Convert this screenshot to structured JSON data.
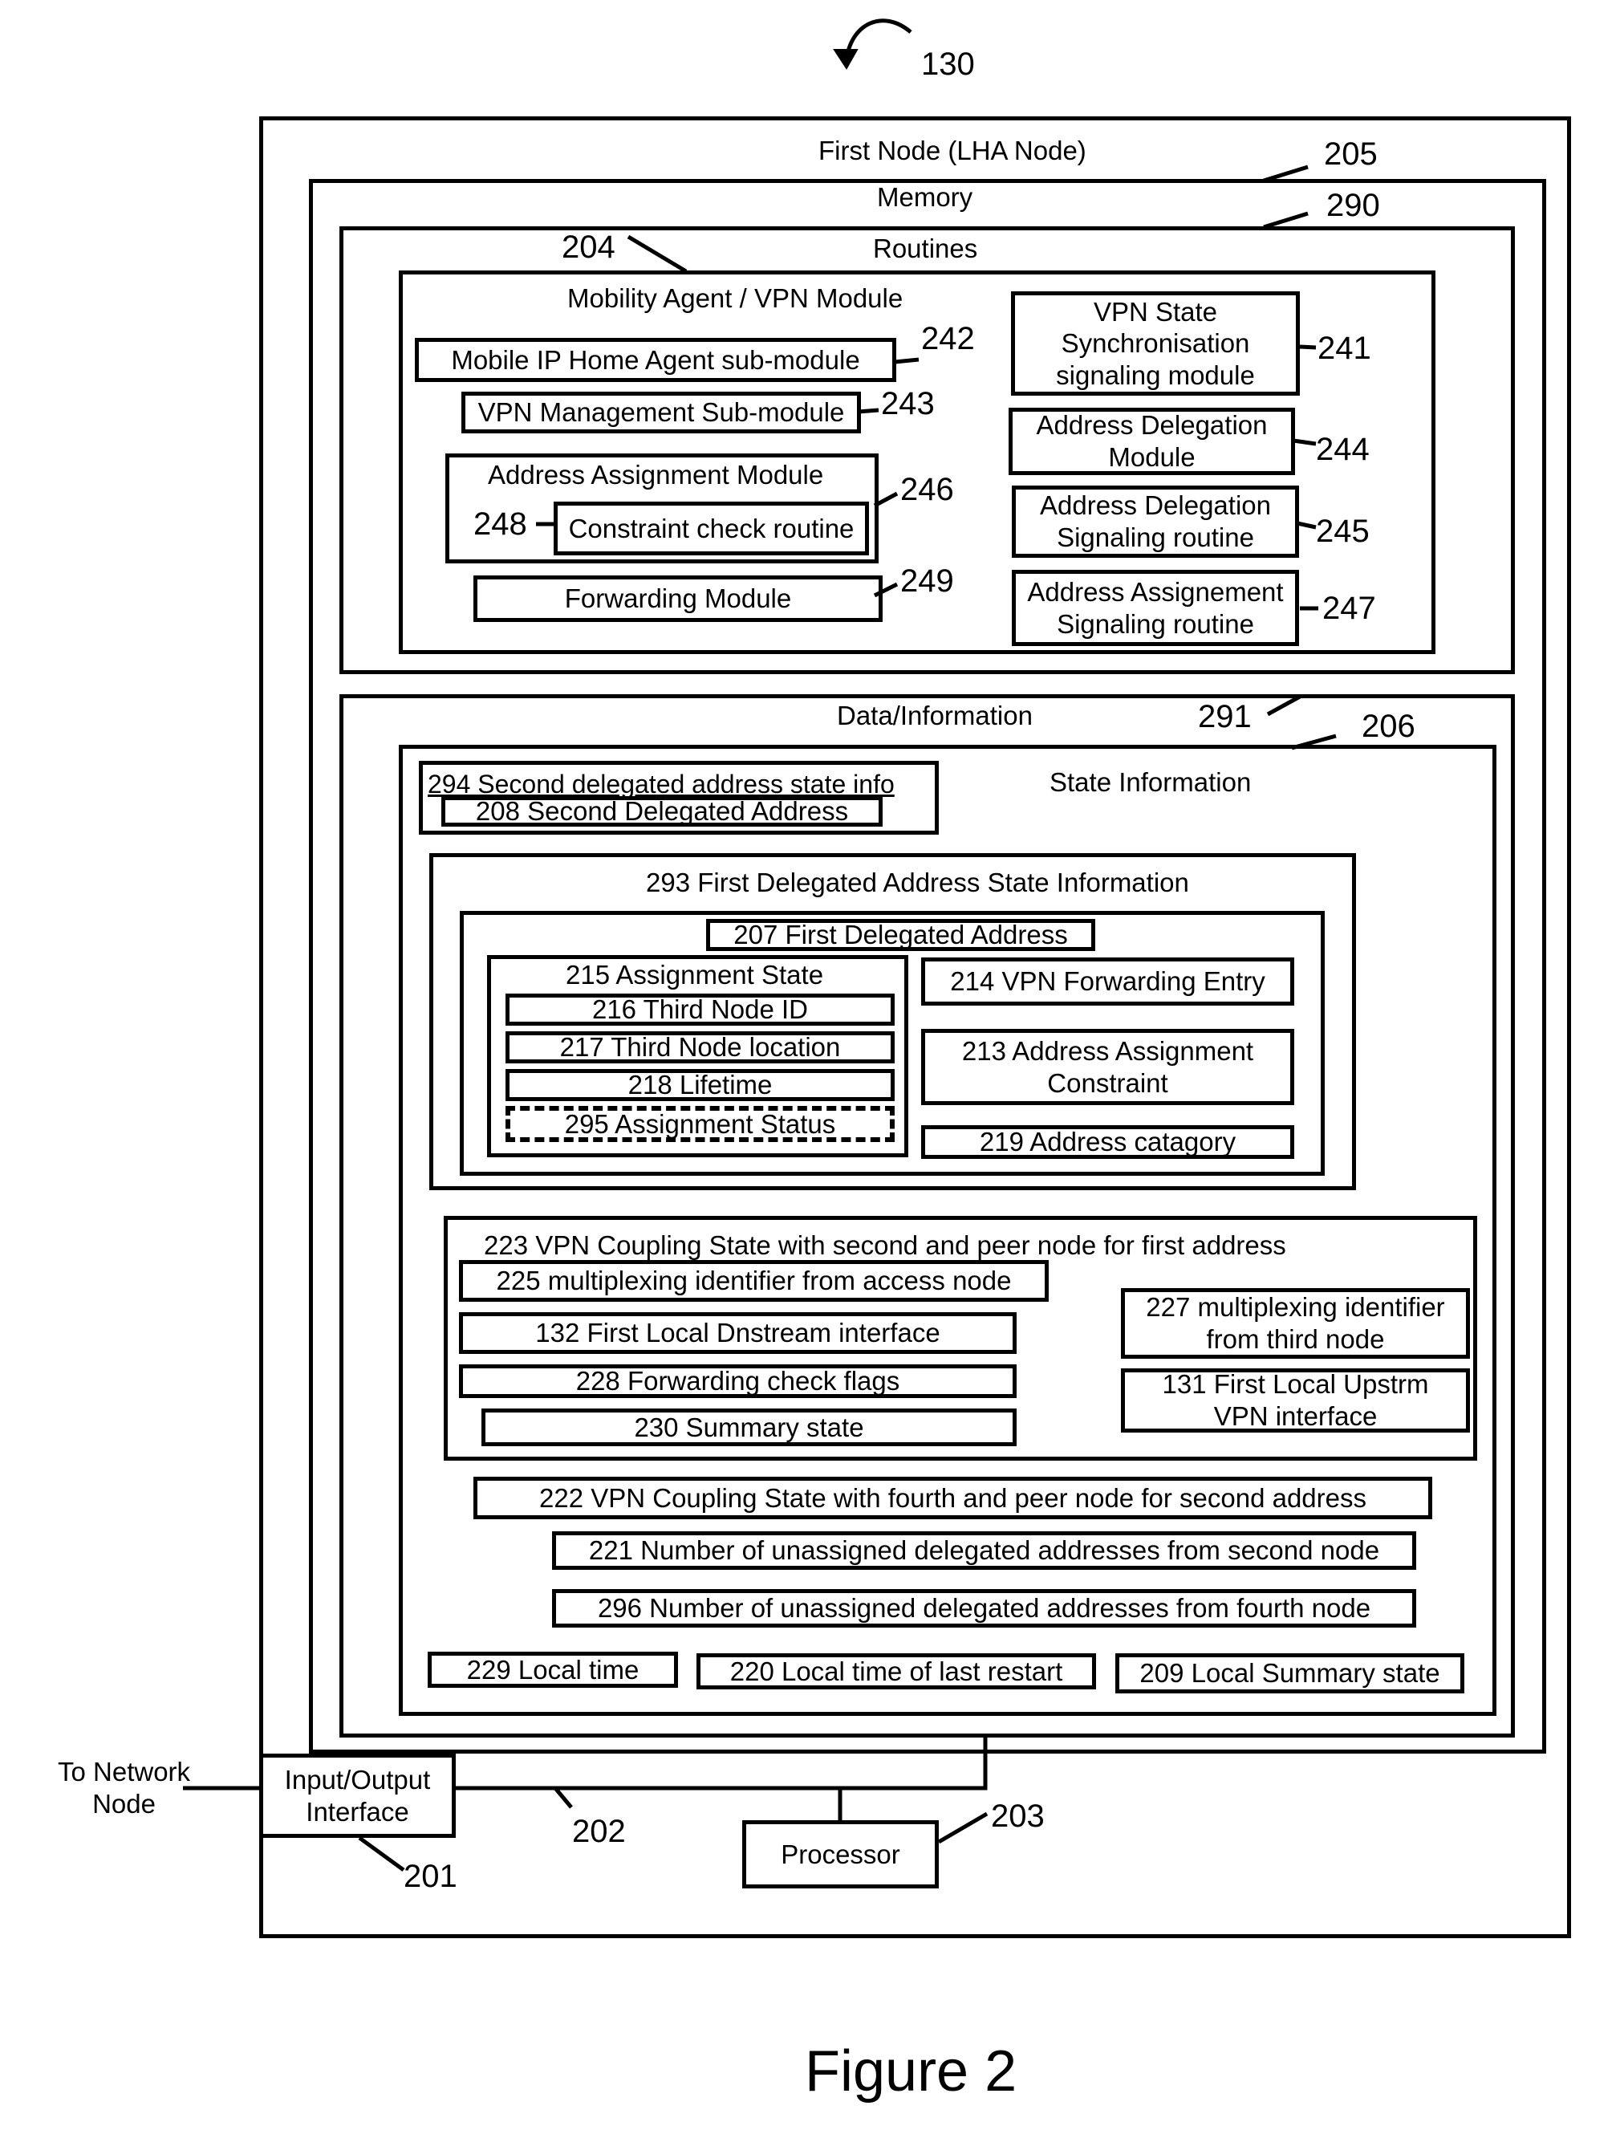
{
  "figure": {
    "ref": "130",
    "caption": "Figure 2"
  },
  "first_node": {
    "title": "First Node (LHA Node)"
  },
  "memory": {
    "title": "Memory",
    "ref": "205"
  },
  "routines": {
    "title": "Routines",
    "ref": "290",
    "mobility_agent": {
      "title": "Mobility Agent / VPN Module",
      "ref": "204",
      "mobile_ip": {
        "label": "Mobile IP Home Agent sub-module",
        "ref": "242"
      },
      "vpn_mgmt": {
        "label": "VPN Management Sub-module",
        "ref": "243"
      },
      "addr_assign": {
        "label": "Address Assignment Module",
        "ref": "246",
        "constraint": {
          "label": "Constraint check routine",
          "ref": "248"
        }
      },
      "forwarding": {
        "label": "Forwarding Module",
        "ref": "249"
      }
    },
    "vpn_state_sync": {
      "line1": "VPN State",
      "line2": "Synchronisation",
      "line3": "signaling module",
      "ref": "241"
    },
    "addr_deleg_module": {
      "line1": "Address Delegation",
      "line2": "Module",
      "ref": "244"
    },
    "addr_deleg_signal": {
      "line1": "Address Delegation",
      "line2": "Signaling routine",
      "ref": "245"
    },
    "addr_assign_signal": {
      "line1": "Address Assignement",
      "line2": "Signaling routine",
      "ref": "247"
    }
  },
  "data_info": {
    "title": "Data/Information",
    "ref": "291",
    "state_info": {
      "title": "State Information",
      "ref": "206",
      "second_deleg": {
        "label": "294 Second delegated address state info",
        "address": "208 Second Delegated Address"
      },
      "first_deleg": {
        "title": "293 First Delegated Address State Information",
        "address": "207 First Delegated Address",
        "assignment_state": {
          "title": "215 Assignment State",
          "items": [
            "216 Third Node ID",
            "217 Third Node location",
            "218 Lifetime"
          ],
          "status": "295 Assignment Status"
        },
        "vpn_fwd": "214 VPN Forwarding Entry",
        "constraint": {
          "line1": "213 Address Assignment",
          "line2": "Constraint"
        },
        "category": "219 Address catagory"
      },
      "coupling_first": {
        "title": "223 VPN Coupling State with second and peer node for first address",
        "mux_access": "225 multiplexing identifier from access node",
        "dnstream": "132 First Local Dnstream interface",
        "fwd_flags": "228 Forwarding check flags",
        "summary": "230 Summary state",
        "mux_third": {
          "line1": "227 multiplexing identifier",
          "line2": "from third node"
        },
        "upstrm": {
          "line1": "131 First Local Upstrm",
          "line2": "VPN interface"
        }
      },
      "coupling_second": "222 VPN Coupling State with fourth and peer node for second address",
      "unassigned_second": "221 Number of unassigned delegated addresses from second node",
      "unassigned_fourth": "296 Number of unassigned delegated addresses from fourth node",
      "local_time": "229 Local time",
      "last_restart": "220 Local time of last restart",
      "local_summary": "209 Local Summary state"
    }
  },
  "io": {
    "line1": "Input/Output",
    "line2": "Interface",
    "ref": "201"
  },
  "bus": {
    "ref": "202"
  },
  "processor": {
    "label": "Processor",
    "ref": "203"
  },
  "network": {
    "line1": "To Network",
    "line2": "Node"
  }
}
